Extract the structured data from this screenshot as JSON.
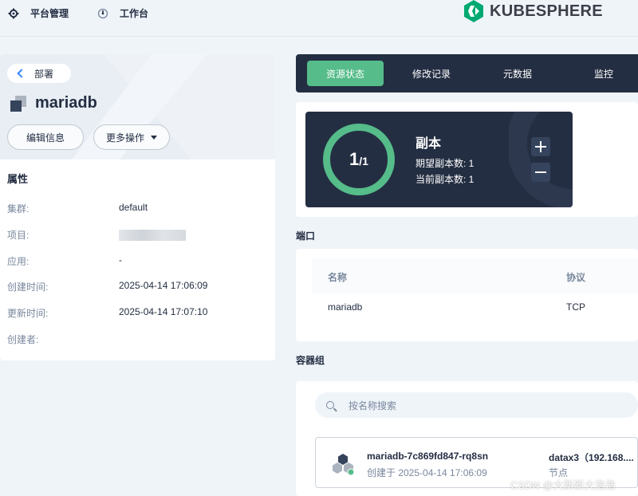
{
  "topnav": {
    "platform_label": "平台管理",
    "workbench_label": "工作台",
    "logo_text": "KUBESPHERE",
    "brand_color": "#00a971"
  },
  "left": {
    "back_label": "部署",
    "resource_name": "mariadb",
    "edit_button": "编辑信息",
    "more_button": "更多操作",
    "attributes_title": "属性",
    "attributes": [
      {
        "key": "集群:",
        "value": "default"
      },
      {
        "key": "项目:",
        "value": ""
      },
      {
        "key": "应用:",
        "value": "-"
      },
      {
        "key": "创建时间:",
        "value": "2025-04-14 17:06:09"
      },
      {
        "key": "更新时间:",
        "value": "2025-04-14 17:07:10"
      },
      {
        "key": "创建者:",
        "value": ""
      }
    ]
  },
  "tabs": [
    {
      "label": "资源状态",
      "active": true
    },
    {
      "label": "修改记录",
      "active": false
    },
    {
      "label": "元数据",
      "active": false
    },
    {
      "label": "监控",
      "active": false
    }
  ],
  "replica": {
    "current": "1",
    "desired_fraction": "/1",
    "title": "副本",
    "desired_label": "期望副本数: 1",
    "current_label": "当前副本数: 1",
    "accent": "#55bc8a"
  },
  "ports": {
    "section_title": "端口",
    "columns": [
      "名称",
      "协议"
    ],
    "rows": [
      [
        "mariadb",
        "TCP"
      ]
    ]
  },
  "pods": {
    "section_title": "容器组",
    "search_placeholder": "按名称搜索",
    "items": [
      {
        "name": "mariadb-7c869fd847-rq8sn",
        "created": "创建于 2025-04-14 17:06:09",
        "node": "datax3（192.168....",
        "node_label": "节点",
        "status_color": "#55bc8a"
      }
    ]
  },
  "watermark": "CSDN @大新新大浩浩"
}
